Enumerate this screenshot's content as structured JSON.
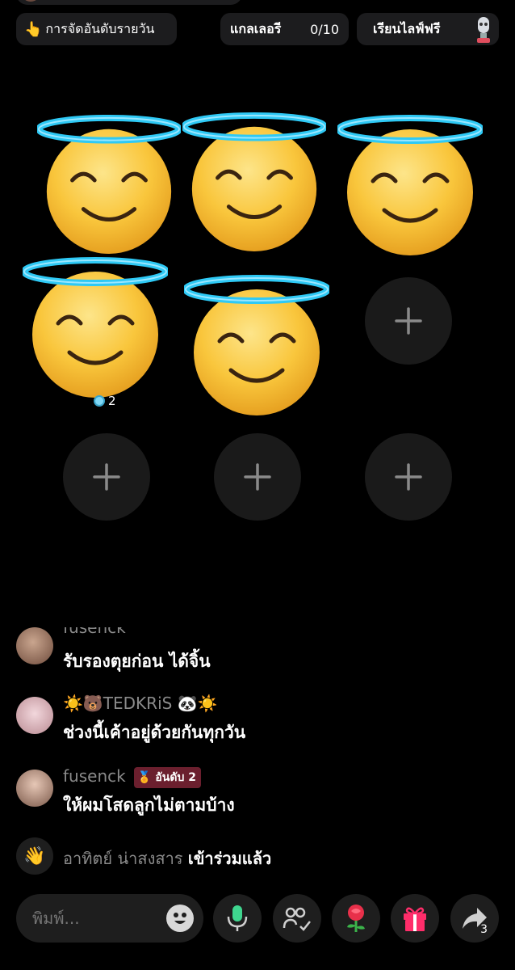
{
  "top": {
    "ranking_label": "การจัดอันดับรายวัน",
    "ranking_icon": "fire-icon",
    "gallery_label": "แกลเลอรี",
    "gallery_count": "0/10",
    "learn_label": "เรียนไลฟ์ฟรี"
  },
  "seats": {
    "seat4_badge_count": "2"
  },
  "chat": {
    "items": [
      {
        "name": "fusenck",
        "message": "รับรองตุยก่อน ได้จิ้น"
      },
      {
        "name": "☀️🐻TEDKRiS 🐼☀️",
        "message": "ช่วงนี้เค้าอยู่ด้วยกันทุกวัน"
      },
      {
        "name": "fusenck",
        "rank": "อันดับ 2",
        "message": "ให้ผมโสดลูกไม่ตามบ้าง"
      }
    ],
    "join_user": "อาทิตย์ น่าสงสาร",
    "join_text": "เข้าร่วมแล้ว"
  },
  "input": {
    "placeholder": "พิมพ์..."
  },
  "share_count": "3",
  "colors": {
    "background": "#000000",
    "pill": "#1c1c1e",
    "seat": "#1a1a1a",
    "mic_green": "#3fd68f",
    "gift_pink": "#ff2d6a",
    "rank_badge": "#6b1f2e"
  }
}
